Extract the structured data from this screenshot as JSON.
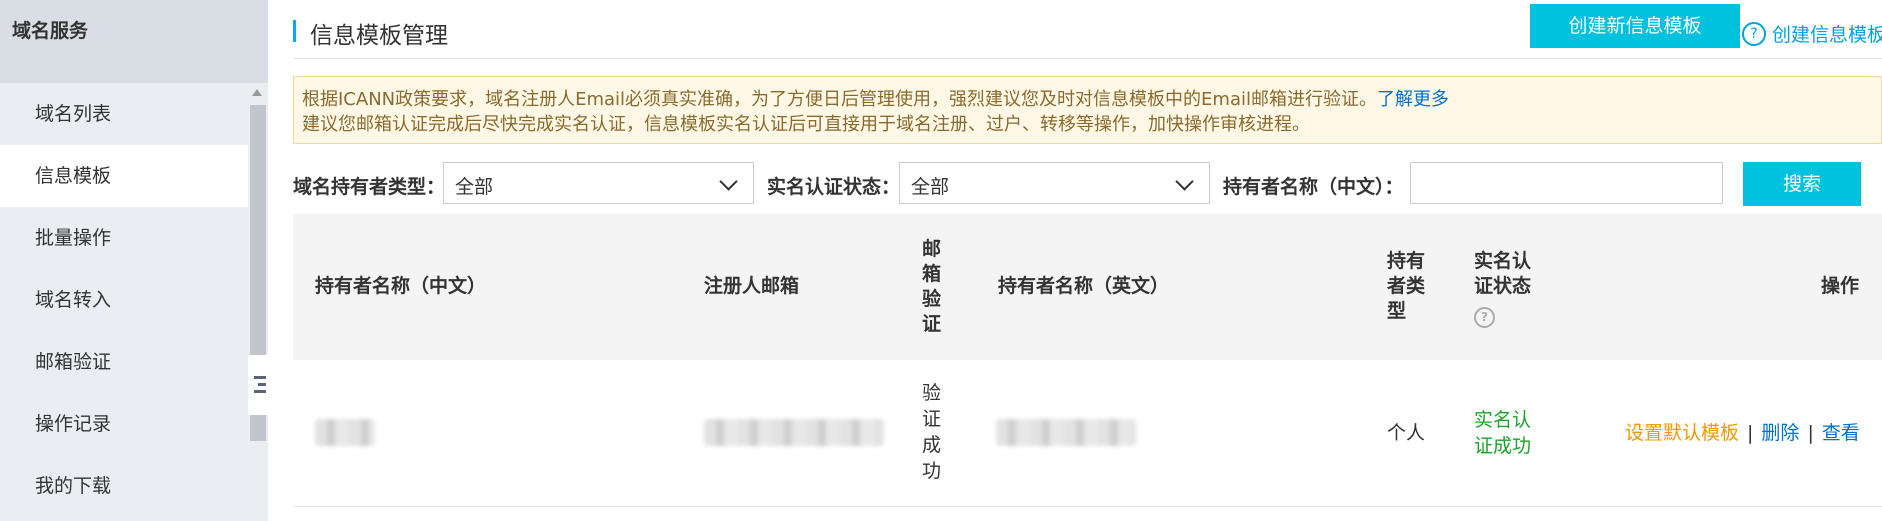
{
  "sidebar": {
    "title": "域名服务",
    "items": [
      {
        "label": "域名列表"
      },
      {
        "label": "信息模板"
      },
      {
        "label": "批量操作"
      },
      {
        "label": "域名转入"
      },
      {
        "label": "邮箱验证"
      },
      {
        "label": "操作记录"
      },
      {
        "label": "我的下载"
      }
    ]
  },
  "header": {
    "title": "信息模板管理",
    "create_button": "创建新信息模板",
    "help_link": "创建信息模板"
  },
  "notice": {
    "line1": "根据ICANN政策要求，域名注册人Email必须真实准确，为了方便日后管理使用，强烈建议您及时对信息模板中的Email邮箱进行验证。",
    "learn_more": "了解更多",
    "line2": "建议您邮箱认证完成后尽快完成实名认证，信息模板实名认证后可直接用于域名注册、过户、转移等操作，加快操作审核进程。"
  },
  "filters": {
    "holder_type_label": "域名持有者类型：",
    "holder_type_value": "全部",
    "verify_status_label": "实名认证状态：",
    "verify_status_value": "全部",
    "holder_name_label": "持有者名称（中文）：",
    "holder_name_value": "",
    "search_button": "搜索"
  },
  "table": {
    "columns": {
      "holder_cn": "持有者名称（中文）",
      "email": "注册人邮箱",
      "email_verify": "邮箱验证",
      "holder_en": "持有者名称（英文）",
      "holder_type": "持有者类型",
      "realname_status": "实名认证状态",
      "actions": "操作"
    },
    "rows": [
      {
        "email_verify": "验证成功",
        "holder_type": "个人",
        "realname_status": "实名认证成功",
        "actions": {
          "set_default": "设置默认模板",
          "delete": "删除",
          "view": "查看"
        }
      }
    ]
  },
  "colors": {
    "accent": "#00c1de",
    "link": "#0070cc",
    "success": "#1aa42b",
    "warning": "#f39800",
    "notice_bg": "#fff8e6"
  }
}
